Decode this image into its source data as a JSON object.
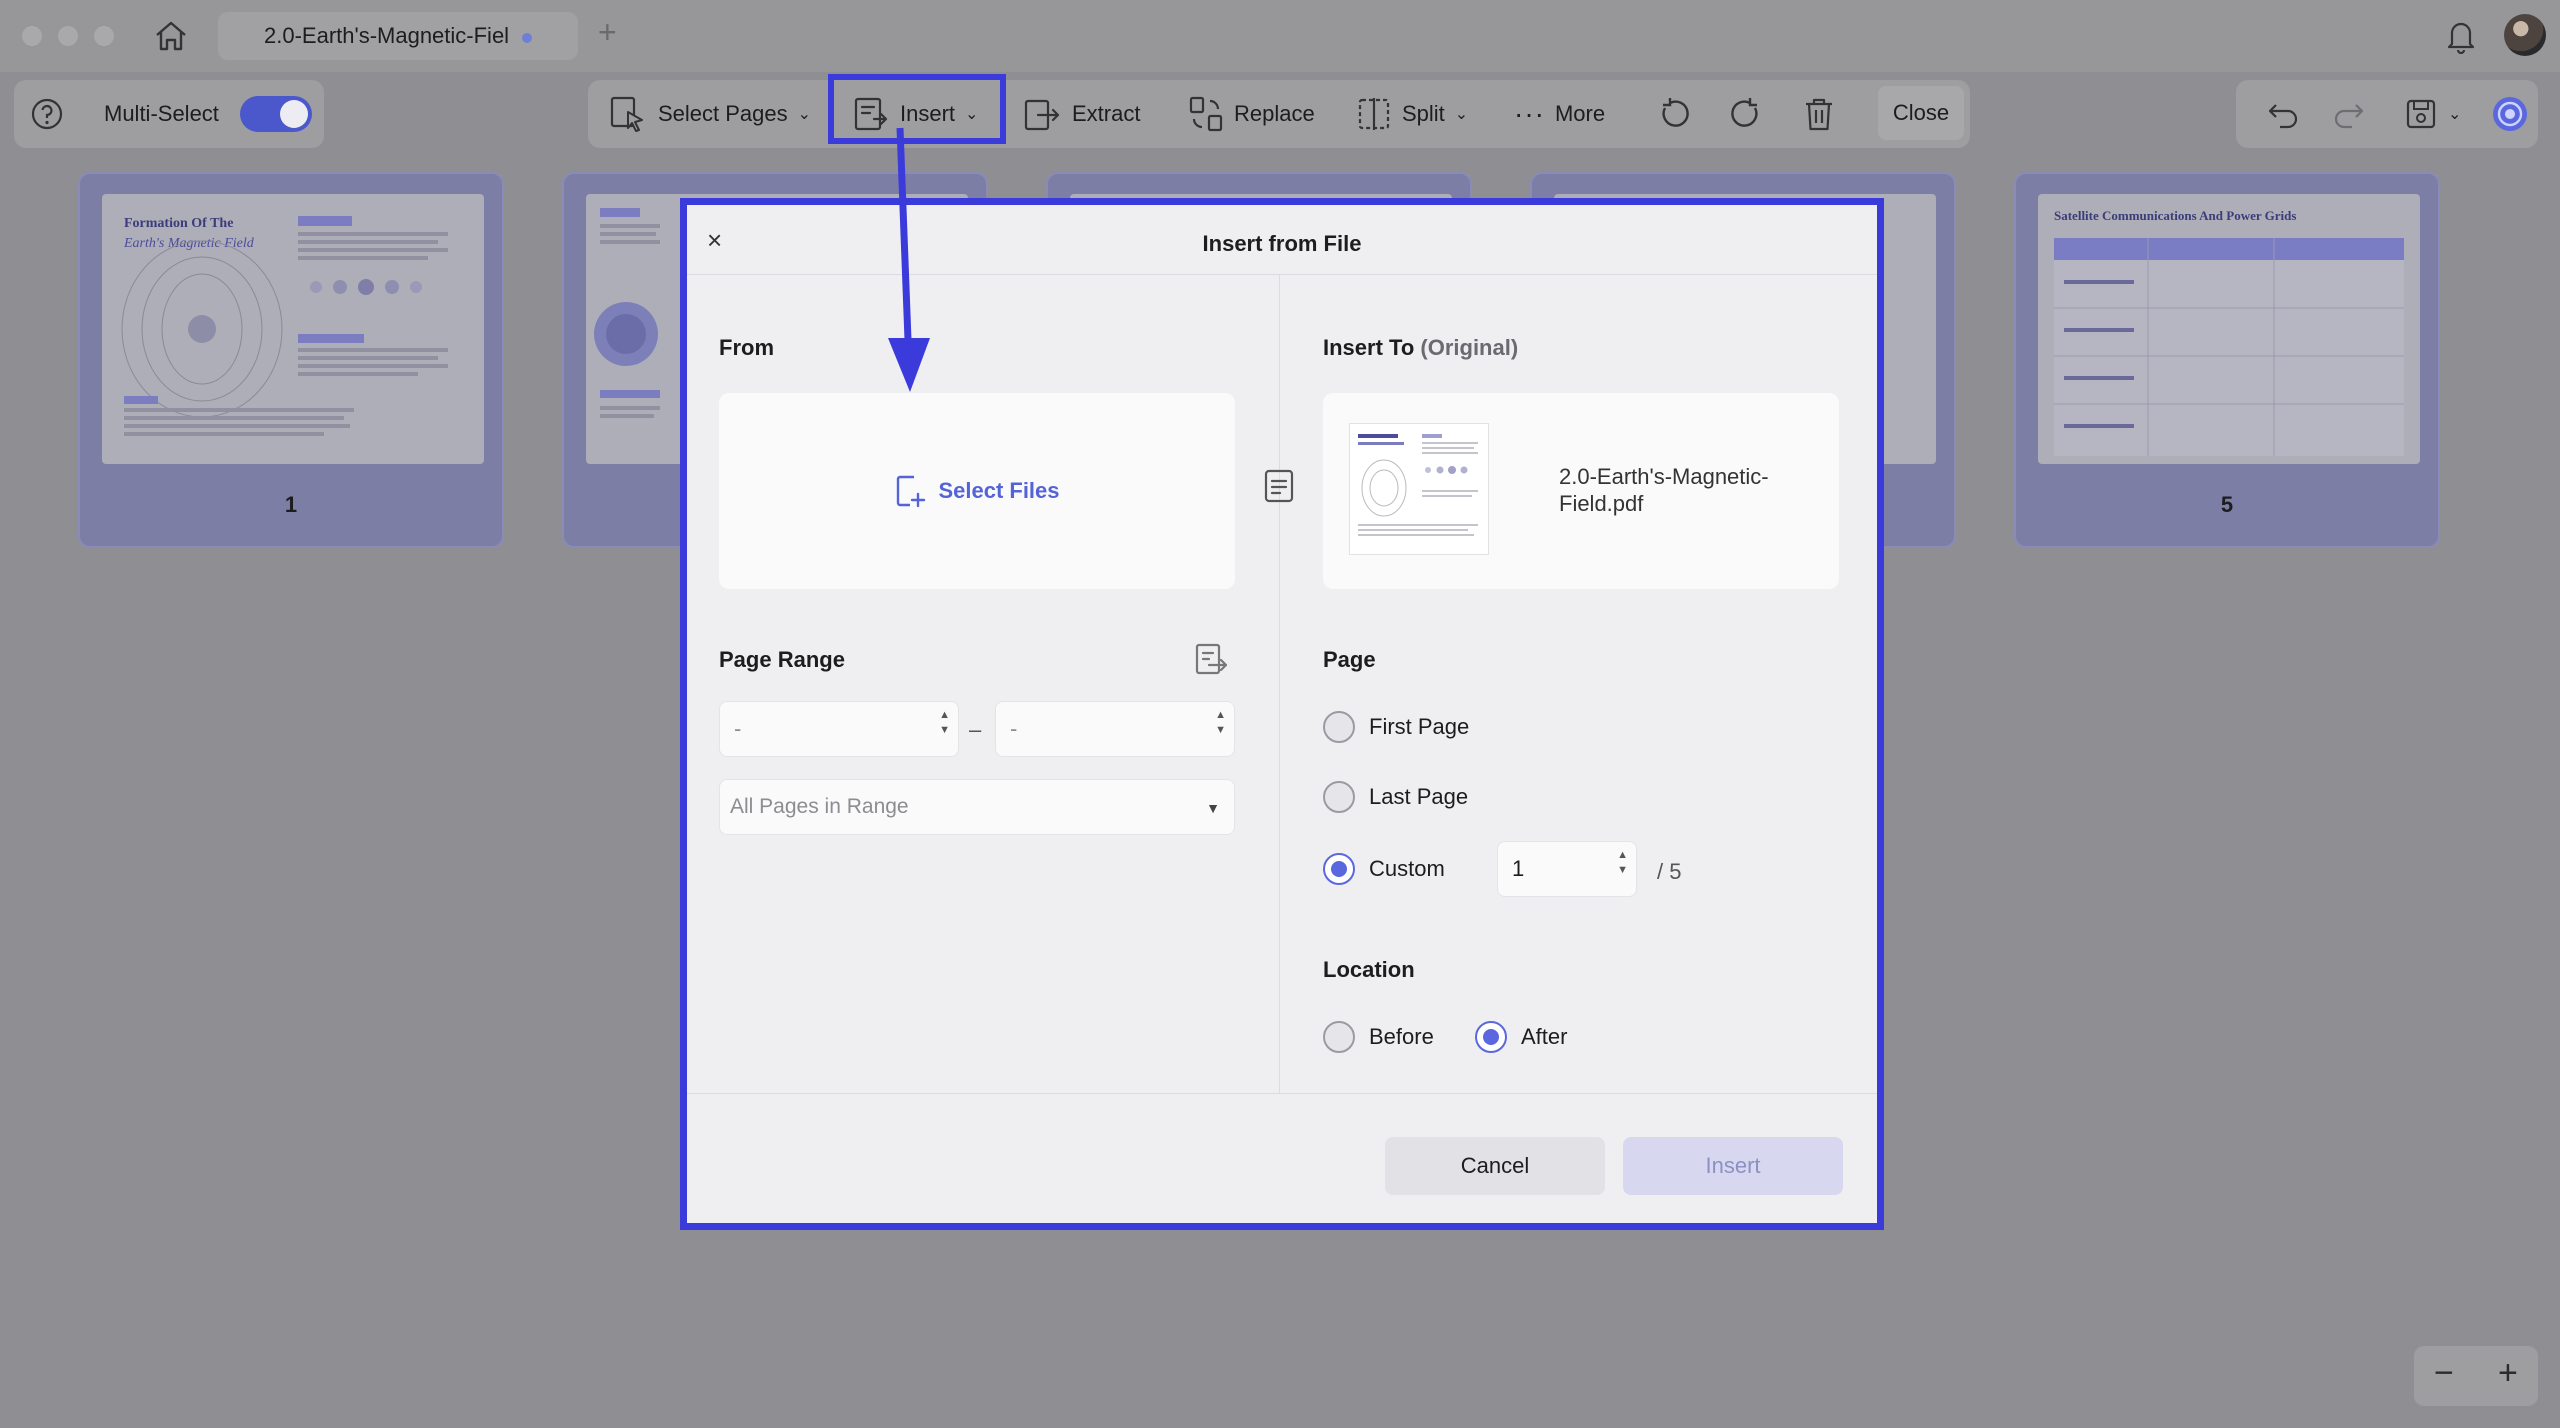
{
  "app": {
    "tab_title": "2.0-Earth's-Magnetic-Fiel",
    "new_tab_symbol": "+"
  },
  "toolbar": {
    "multi_select_label": "Multi-Select",
    "multi_select_on": true,
    "select_pages_label": "Select Pages",
    "insert_label": "Insert",
    "extract_label": "Extract",
    "replace_label": "Replace",
    "split_label": "Split",
    "more_label": "More",
    "close_label": "Close"
  },
  "pages": [
    {
      "number": "1",
      "title_line1": "Formation Of The",
      "title_line2": "Earth's Magnetic Field"
    },
    {
      "number": "",
      "title_line1": "",
      "title_line2": ""
    },
    {
      "number": "",
      "title_line1": "",
      "title_line2": ""
    },
    {
      "number": "",
      "title_line1": "",
      "title_line2": ""
    },
    {
      "number": "5",
      "title_line1": "Satellite Communications And Power Grids",
      "title_line2": ""
    }
  ],
  "dialog": {
    "title": "Insert from File",
    "close_symbol": "×",
    "from_label": "From",
    "select_files_label": "Select Files",
    "page_range_label": "Page Range",
    "range_start_placeholder": "-",
    "range_end_placeholder": "-",
    "range_separator": "–",
    "range_filter": "All Pages in Range",
    "insert_to_label": "Insert To",
    "insert_to_note": "(Original)",
    "target_file": "2.0-Earth's-Magnetic-Field.pdf",
    "page_label": "Page",
    "page_options": {
      "first": "First Page",
      "last": "Last Page",
      "custom": "Custom"
    },
    "selected_page_option": "custom",
    "custom_page_value": "1",
    "custom_page_total": "/ 5",
    "location_label": "Location",
    "location_options": {
      "before": "Before",
      "after": "After"
    },
    "selected_location": "after",
    "cancel_label": "Cancel",
    "insert_label": "Insert"
  },
  "zoom": {
    "out_symbol": "−",
    "in_symbol": "+"
  },
  "colors": {
    "accent": "#5a67df",
    "highlight": "#3b3bdb",
    "overlay": "#8f8f93"
  }
}
